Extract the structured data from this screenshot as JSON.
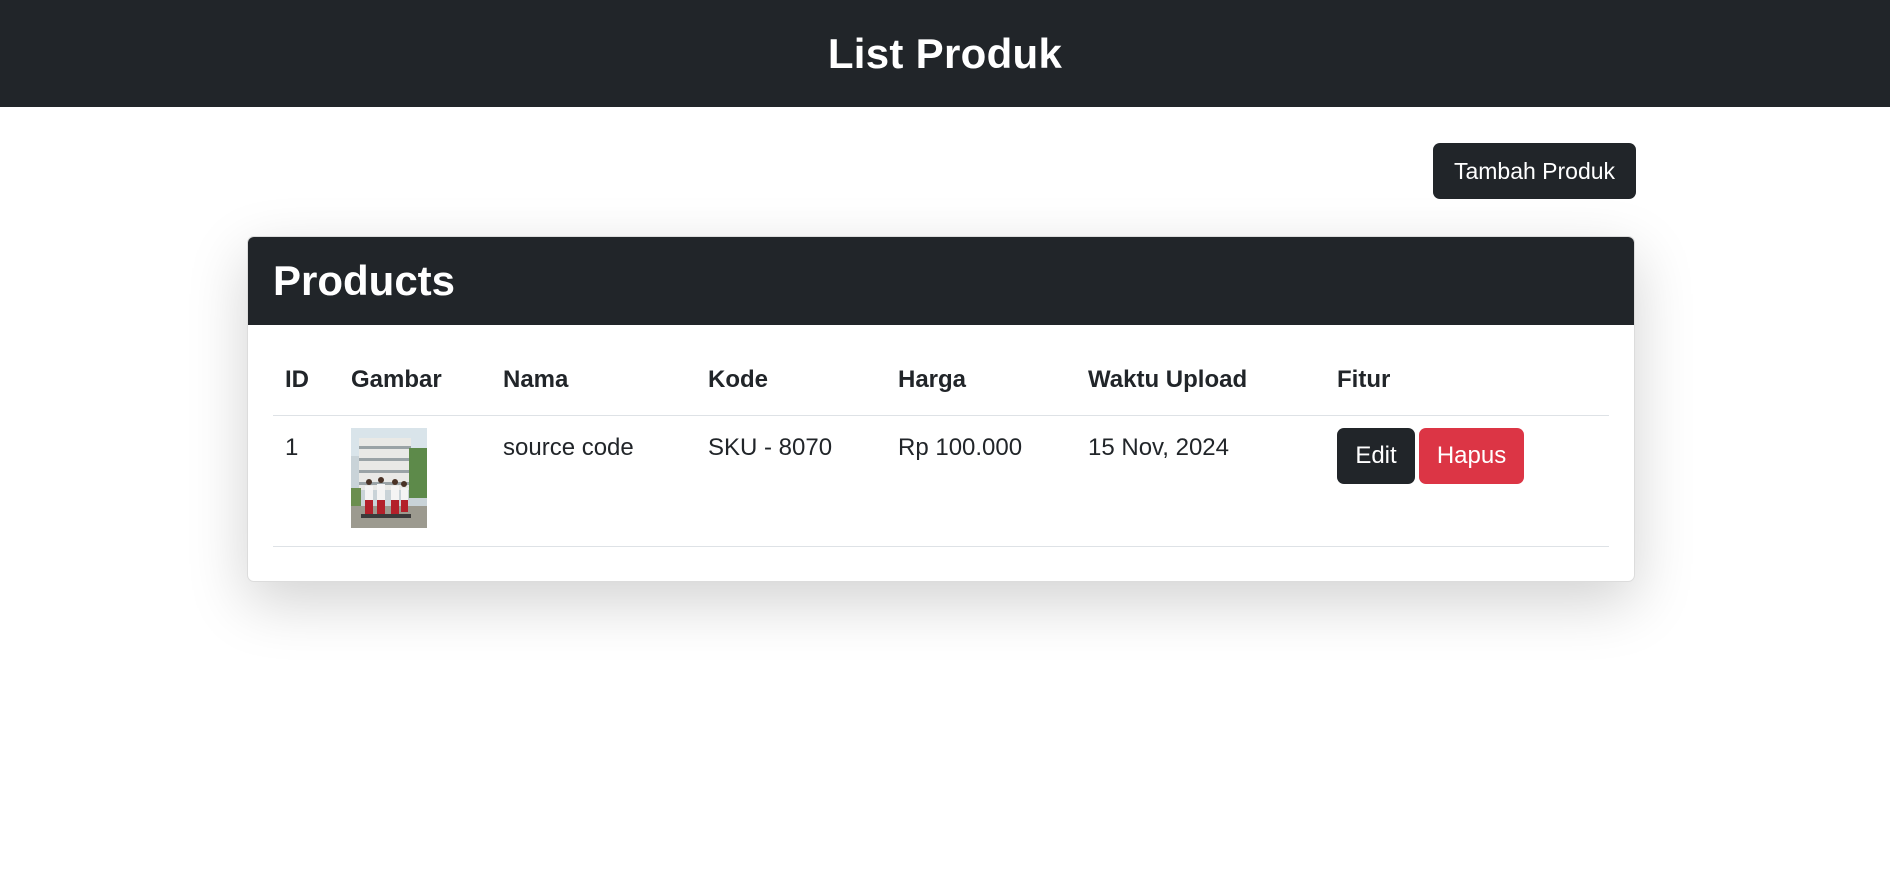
{
  "header": {
    "title": "List Produk"
  },
  "actions": {
    "add_label": "Tambah Produk"
  },
  "card": {
    "title": "Products"
  },
  "table": {
    "columns": [
      "ID",
      "Gambar",
      "Nama",
      "Kode",
      "Harga",
      "Waktu Upload",
      "Fitur"
    ],
    "rows": [
      {
        "id": "1",
        "nama": "source code",
        "kode": "SKU - 8070",
        "harga": "Rp 100.000",
        "waktu": "15 Nov, 2024",
        "edit_label": "Edit",
        "delete_label": "Hapus"
      }
    ]
  },
  "colors": {
    "dark": "#212529",
    "danger": "#dc3545"
  }
}
